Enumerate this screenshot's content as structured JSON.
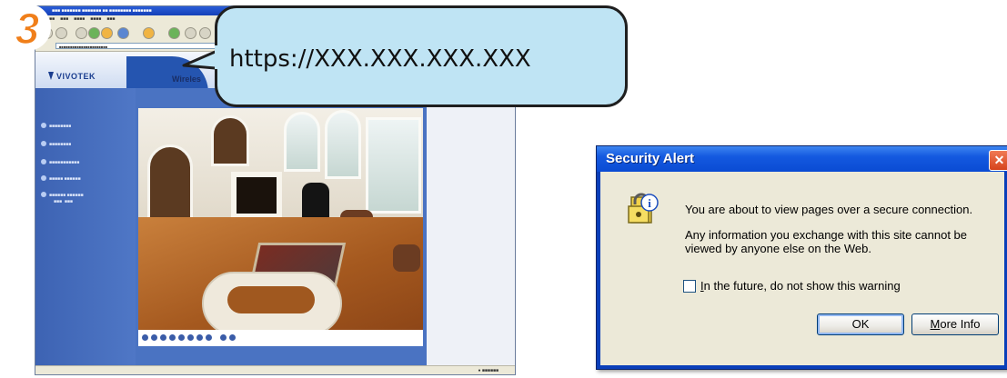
{
  "step_number": "3",
  "url_callout": {
    "text": "https://XXX.XXX.XXX.XXX"
  },
  "browser": {
    "logo_text": "VIVOTEK",
    "header_title": "Wireles"
  },
  "dialog": {
    "title": "Security Alert",
    "close_glyph": "✕",
    "message_primary": "You are about to view pages over a secure connection.",
    "message_secondary": "Any information you exchange with this site cannot be viewed by anyone else on the Web.",
    "checkbox": {
      "accelerator": "I",
      "label_rest": "n the future, do not show this warning",
      "checked": false
    },
    "ok_button": "OK",
    "more_info_button": {
      "accelerator": "M",
      "rest": "ore Info"
    },
    "icon": "lock-info-icon"
  },
  "colors": {
    "callout_fill": "#bfe4f4",
    "step_badge": "#f07f1a",
    "xp_title_blue": "#0a4bd3",
    "close_red": "#d6431c"
  }
}
